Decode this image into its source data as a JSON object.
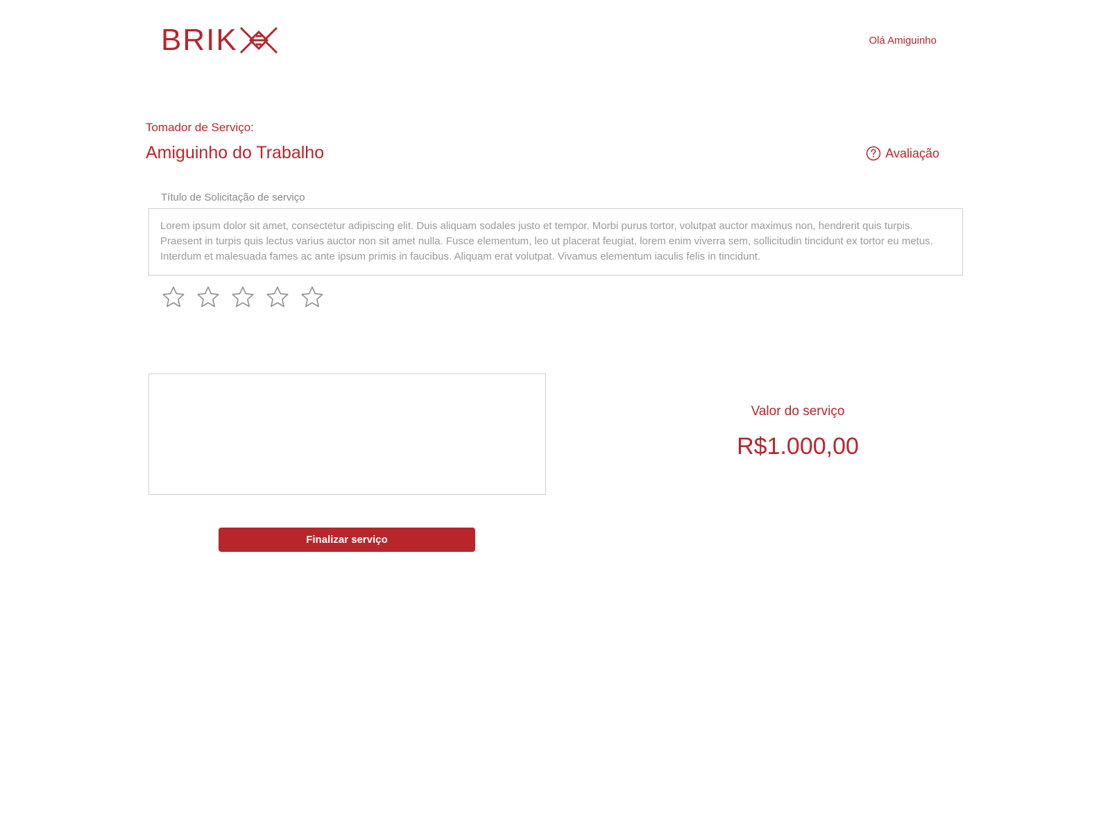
{
  "header": {
    "logo_text": "BRIK",
    "greeting": "Olá Amiguinho"
  },
  "client": {
    "caption": "Tomador de Serviço:",
    "name": "Amiguinho do Trabalho"
  },
  "evaluation": {
    "label": "Avaliação",
    "icon": "help-circle-icon"
  },
  "request": {
    "title": "Título de Solicitação de serviço",
    "description": "Lorem ipsum dolor sit amet, consectetur adipiscing elit. Duis aliquam sodales justo et tempor. Morbi purus tortor, volutpat auctor maximus non, hendrerit quis turpis. Praesent in turpis quis lectus varius auctor non sit amet nulla. Fusce elementum, leo ut placerat feugiat, lorem enim viverra sem, sollicitudin tincidunt ex tortor eu metus. Interdum et malesuada fames ac ante ipsum primis in faucibus. Aliquam erat volutpat. Vivamus elementum iaculis felis in tincidunt."
  },
  "rating": {
    "max": 5,
    "value": 0,
    "icon": "star-outline-icon"
  },
  "comment": {
    "value": ""
  },
  "service_value": {
    "caption": "Valor do serviço",
    "amount": "R$1.000,00"
  },
  "actions": {
    "finish_label": "Finalizar serviço"
  },
  "colors": {
    "brand": "#b8262c",
    "muted_text": "#9a9a9a",
    "border": "#cfcfcf",
    "star_outline": "#8f8f8f"
  }
}
